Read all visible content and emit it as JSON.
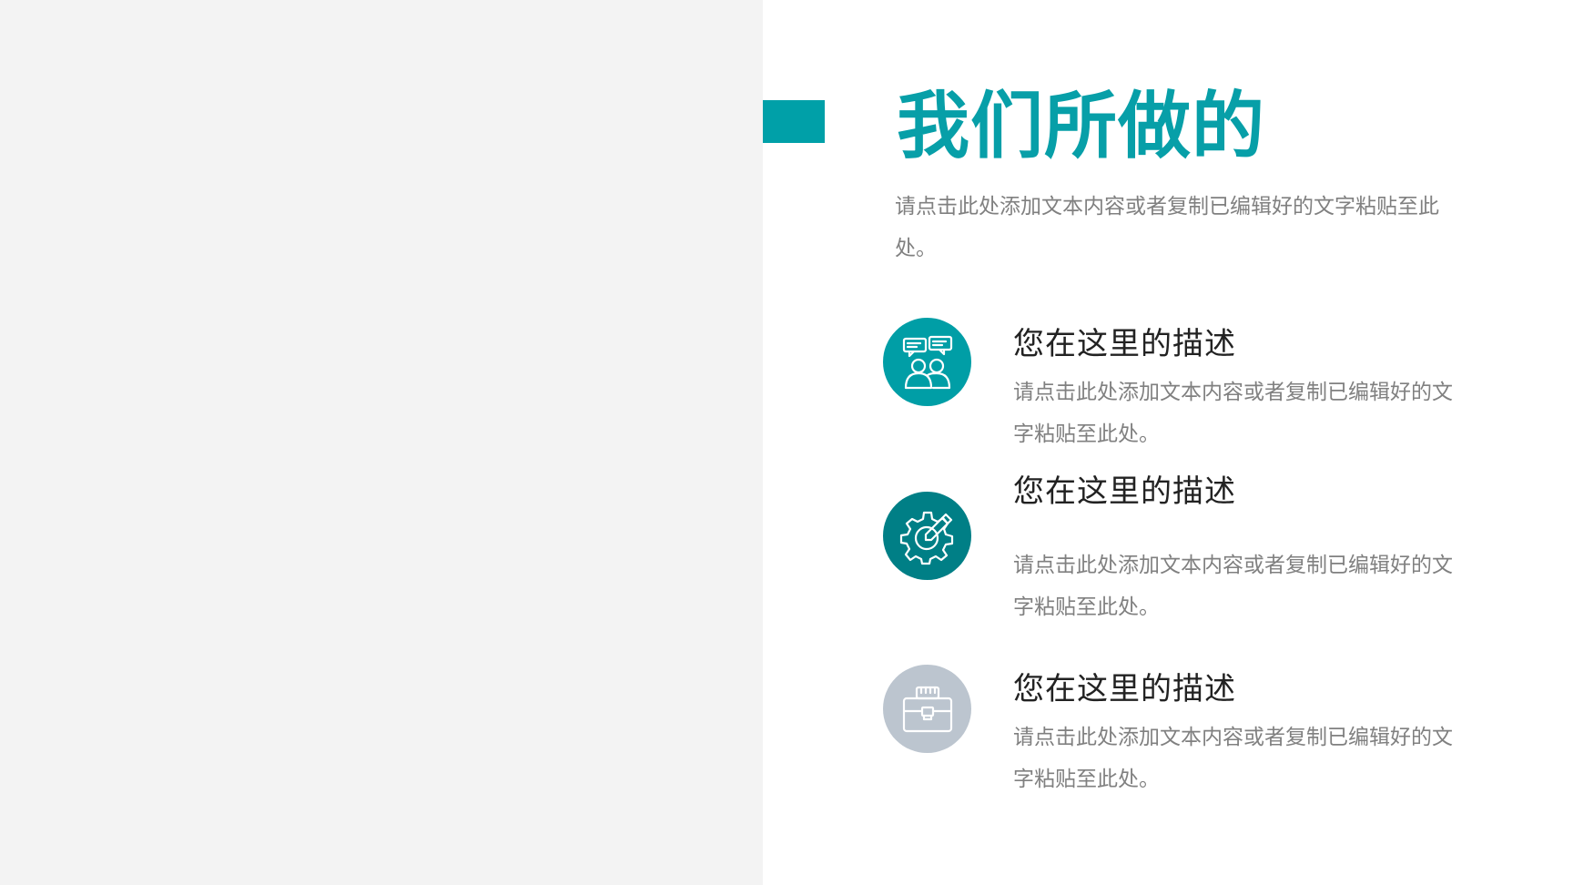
{
  "slide": {
    "title": "我们所做的",
    "intro": "请点击此处添加文本内容或者复制已编辑好的文字粘贴至此处。"
  },
  "features": [
    {
      "icon": "team-chat-icon",
      "title": "您在这里的描述",
      "description": "请点击此处添加文本内容或者复制已编辑好的文字粘贴至此处。"
    },
    {
      "icon": "gear-pencil-icon",
      "title": "您在这里的描述",
      "description": "请点击此处添加文本内容或者复制已编辑好的文字粘贴至此处。"
    },
    {
      "icon": "briefcase-icon",
      "title": "您在这里的描述",
      "description": "请点击此处添加文本内容或者复制已编辑好的文字粘贴至此处。"
    }
  ],
  "colors": {
    "accent": "#00a0a8",
    "icon_teal": "#009ea6",
    "icon_dark_teal": "#007f86",
    "icon_gray": "#bcc5cf",
    "panel_gray": "#f3f3f3"
  }
}
